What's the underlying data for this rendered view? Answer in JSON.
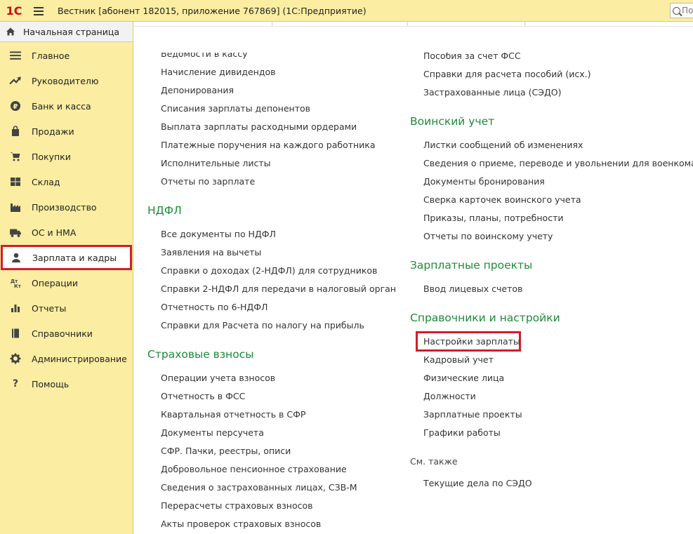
{
  "titlebar": {
    "logo": "1С",
    "title": "Вестник [абонент 182015, приложение 767869]  (1С:Предприятие)",
    "search_placeholder": "По"
  },
  "sidebar": {
    "home": "Начальная страница",
    "items": [
      {
        "label": "Главное",
        "icon": "menu-lines-icon"
      },
      {
        "label": "Руководителю",
        "icon": "trend-up-icon"
      },
      {
        "label": "Банк и касса",
        "icon": "ruble-coin-icon"
      },
      {
        "label": "Продажи",
        "icon": "shopping-bag-icon"
      },
      {
        "label": "Покупки",
        "icon": "cart-icon"
      },
      {
        "label": "Склад",
        "icon": "grid-icon"
      },
      {
        "label": "Производство",
        "icon": "factory-icon"
      },
      {
        "label": "ОС и НМА",
        "icon": "truck-icon"
      },
      {
        "label": "Зарплата и кадры",
        "icon": "person-icon"
      },
      {
        "label": "Операции",
        "icon": "debit-credit-icon"
      },
      {
        "label": "Отчеты",
        "icon": "bar-chart-icon"
      },
      {
        "label": "Справочники",
        "icon": "book-icon"
      },
      {
        "label": "Администрирование",
        "icon": "gear-icon"
      },
      {
        "label": "Помощь",
        "icon": "question-icon"
      }
    ]
  },
  "left_column": {
    "top_links": [
      "Ведомости в кассу",
      "Начисление дивидендов",
      "Депонирования",
      "Списания зарплаты депонентов",
      "Выплата зарплаты расходными ордерами",
      "Платежные поручения на каждого работника",
      "Исполнительные листы",
      "Отчеты по зарплате"
    ],
    "ndfl": {
      "title": "НДФЛ",
      "links": [
        "Все документы по НДФЛ",
        "Заявления на вычеты",
        "Справки о доходах (2-НДФЛ) для сотрудников",
        "Справки 2-НДФЛ для передачи в налоговый орган",
        "Отчетность по 6-НДФЛ",
        "Справки для Расчета по налогу на прибыль"
      ]
    },
    "insurance": {
      "title": "Страховые взносы",
      "links": [
        "Операции учета взносов",
        "Отчетность в ФСС",
        "Квартальная отчетность в СФР",
        "Документы персучета",
        "СФР. Пачки, реестры, описи",
        "Добровольное пенсионное страхование",
        "Сведения о застрахованных лицах, СЗВ-М",
        "Перерасчеты страховых взносов",
        "Акты проверок страховых взносов"
      ]
    }
  },
  "right_column": {
    "top_links": [
      "Пособия за счет ФСС",
      "Справки для расчета пособий (исх.)",
      "Застрахованные лица (СЭДО)"
    ],
    "military": {
      "title": "Воинский учет",
      "links": [
        "Листки сообщений об изменениях",
        "Сведения о приеме, переводе и увольнении для военкомата",
        "Документы бронирования",
        "Сверка карточек воинского учета",
        "Приказы, планы, потребности",
        "Отчеты по воинскому учету"
      ]
    },
    "salary_projects": {
      "title": "Зарплатные проекты",
      "links": [
        "Ввод лицевых счетов"
      ]
    },
    "settings": {
      "title": "Справочники и настройки",
      "links": [
        "Настройки зарплаты",
        "Кадровый учет",
        "Физические лица",
        "Должности",
        "Зарплатные проекты",
        "Графики работы"
      ]
    },
    "see_also": {
      "title": "См. также",
      "links": [
        "Текущие дела по СЭДО"
      ]
    }
  },
  "colors": {
    "panel_bg": "#fbeda1",
    "section_green": "#1e8a3c",
    "highlight_red": "#d21d2a"
  }
}
